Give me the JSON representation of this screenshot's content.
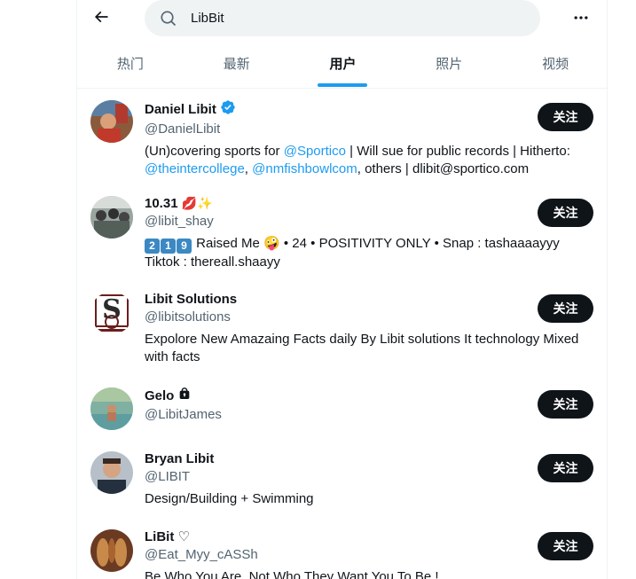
{
  "search": {
    "query": "LibBit"
  },
  "icons": {
    "back": "arrow-left-icon",
    "search": "search-icon",
    "more": "more-horizontal-icon",
    "verified": "verified-badge-icon",
    "lock": "lock-icon"
  },
  "colors": {
    "accent": "#1d9bf0",
    "text": "#0f1419",
    "secondary": "#536471",
    "button": "#0f1419"
  },
  "tabs": [
    {
      "label": "热门"
    },
    {
      "label": "最新"
    },
    {
      "label": "用户",
      "active": true
    },
    {
      "label": "照片"
    },
    {
      "label": "视频"
    }
  ],
  "users": [
    {
      "name": "Daniel Libit",
      "handle": "@DanielLibit",
      "verified": true,
      "follow_label": "关注",
      "bio": {
        "p1": "(Un)covering sports for ",
        "l1": "@Sportico",
        "p2": " | Will sue for public records | Hitherto: ",
        "l2": "@theintercollege",
        "p3": ", ",
        "l3": "@nmfishbowlcom",
        "p4": ", others | dlibit@sportico.com"
      }
    },
    {
      "name": "10.31 💋✨",
      "name_text": "10.31",
      "name_emoji": "💋✨",
      "handle": "@libit_shay",
      "follow_label": "关注",
      "bio_keys": [
        "2",
        "1",
        "9"
      ],
      "bio_rest": " Raised Me 🤪 • 24 • POSITIVITY ONLY • Snap : tashaaaayyy Tiktok : thereall.shaayy"
    },
    {
      "name": "Libit Solutions",
      "handle": "@libitsolutions",
      "follow_label": "关注",
      "bio": "Expolore New Amazaing Facts daily By Libit solutions It technology Mixed with facts"
    },
    {
      "name": "Gelo",
      "handle": "@LibitJames",
      "protected": true,
      "follow_label": "关注"
    },
    {
      "name": "Bryan Libit",
      "handle": "@LIBIT",
      "follow_label": "关注",
      "bio": "Design/Building + Swimming"
    },
    {
      "name": "LiBit ♡",
      "handle": "@Eat_Myy_cASSh",
      "follow_label": "关注",
      "bio": "Be Who You Are, Not Who They Want You To Be !"
    }
  ]
}
